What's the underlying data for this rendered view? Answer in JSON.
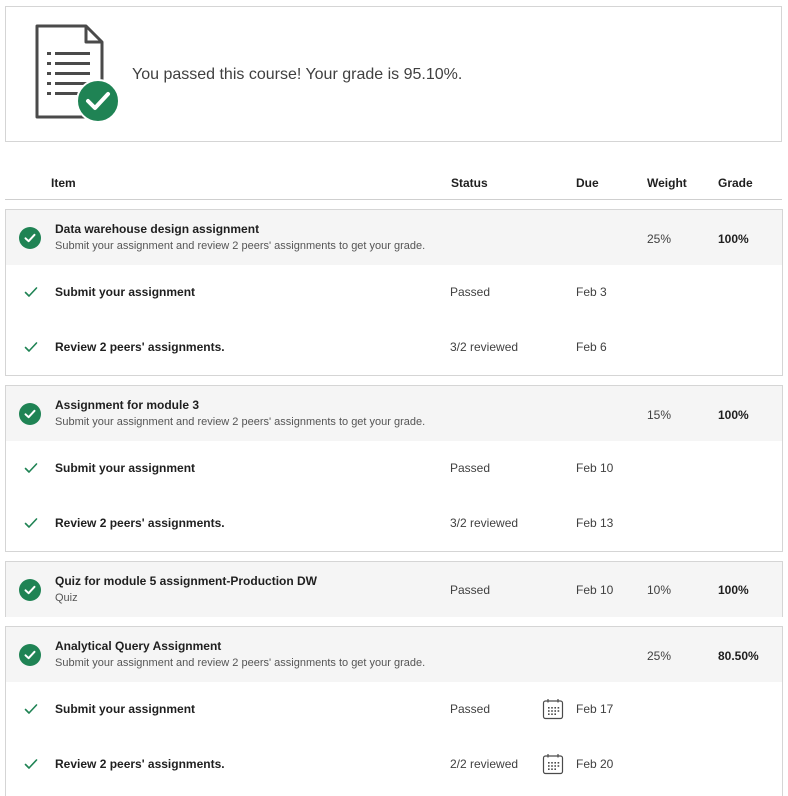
{
  "banner": {
    "message": "You passed this course! Your grade is 95.10%."
  },
  "table_header": {
    "item": "Item",
    "status": "Status",
    "due": "Due",
    "weight": "Weight",
    "grade": "Grade"
  },
  "groups": [
    {
      "title": "Data warehouse design assignment",
      "subtitle": "Submit your assignment and review 2 peers' assignments to get your grade.",
      "weight": "25%",
      "grade": "100%",
      "rows": [
        {
          "label": "Submit your assignment",
          "status": "Passed",
          "due": "Feb 3"
        },
        {
          "label": "Review 2 peers' assignments.",
          "status": "3/2 reviewed",
          "due": "Feb 6"
        }
      ]
    },
    {
      "title": "Assignment for module 3",
      "subtitle": "Submit your assignment and review 2 peers' assignments to get your grade.",
      "weight": "15%",
      "grade": "100%",
      "rows": [
        {
          "label": "Submit your assignment",
          "status": "Passed",
          "due": "Feb 10"
        },
        {
          "label": "Review 2 peers' assignments.",
          "status": "3/2 reviewed",
          "due": "Feb 13"
        }
      ]
    },
    {
      "title": "Quiz for module 5 assignment-Production DW",
      "subtitle": "Quiz",
      "status": "Passed",
      "due": "Feb 10",
      "weight": "10%",
      "grade": "100%"
    },
    {
      "title": "Analytical Query Assignment",
      "subtitle": "Submit your assignment and review 2 peers' assignments to get your grade.",
      "weight": "25%",
      "grade": "80.50%",
      "rows": [
        {
          "label": "Submit your assignment",
          "status": "Passed",
          "due": "Feb 17"
        },
        {
          "label": "Review 2 peers' assignments.",
          "status": "2/2 reviewed",
          "due": "Feb 20"
        }
      ]
    }
  ],
  "colors": {
    "success": "#1f8354",
    "row_header_bg": "#f5f5f5",
    "border": "#d5d5d5"
  }
}
